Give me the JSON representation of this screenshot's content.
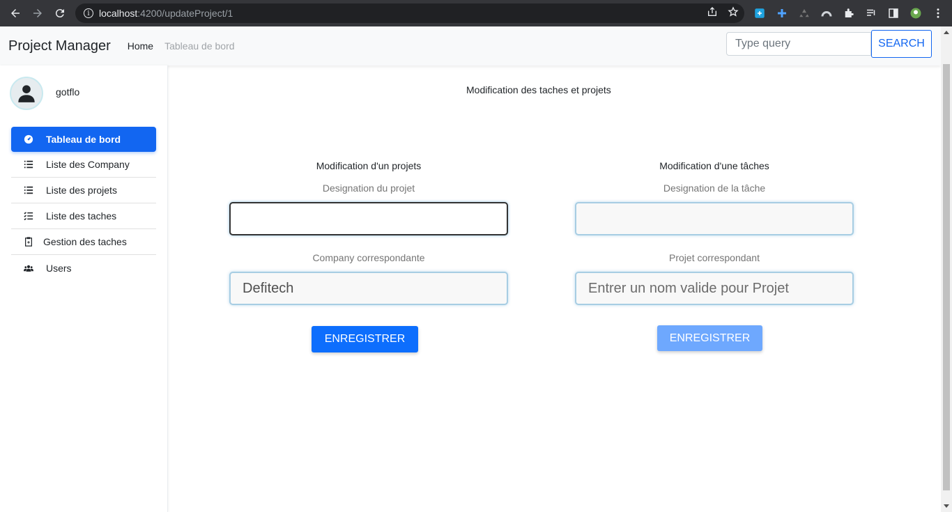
{
  "browser": {
    "url_host": "localhost",
    "url_path": ":4200/updateProject/1"
  },
  "navbar": {
    "brand": "Project Manager",
    "links": [
      "Home",
      "Tableau de bord"
    ],
    "search_placeholder": "Type query",
    "search_button": "SEARCH"
  },
  "sidebar": {
    "username": "gotflo",
    "items": [
      {
        "label": "Tableau de bord",
        "icon": "gauge-icon",
        "active": true
      },
      {
        "label": "Liste des Company",
        "icon": "list-icon",
        "active": false
      },
      {
        "label": "Liste des projets",
        "icon": "list-icon",
        "active": false
      },
      {
        "label": "Liste des taches",
        "icon": "list-check-icon",
        "active": false
      },
      {
        "label": "Gestion des taches",
        "icon": "clipboard-icon",
        "active": false
      },
      {
        "label": "Users",
        "icon": "users-icon",
        "active": false
      }
    ]
  },
  "main": {
    "title": "Modification des taches et projets",
    "project_form": {
      "heading": "Modification d'un projets",
      "designation_label": "Designation du projet",
      "designation_value": "",
      "company_label": "Company correspondante",
      "company_value": "Defitech",
      "save_label": "ENREGISTRER"
    },
    "task_form": {
      "heading": "Modification d'une tâches",
      "designation_label": "Designation de la tâche",
      "designation_value": "",
      "project_label": "Projet correspondant",
      "project_placeholder": "Entrer un nom valide pour Projet",
      "save_label": "ENREGISTRER"
    }
  },
  "colors": {
    "primary": "#1266f1",
    "primary_disabled": "#6ea8fe",
    "browser_chrome": "#35363a"
  }
}
